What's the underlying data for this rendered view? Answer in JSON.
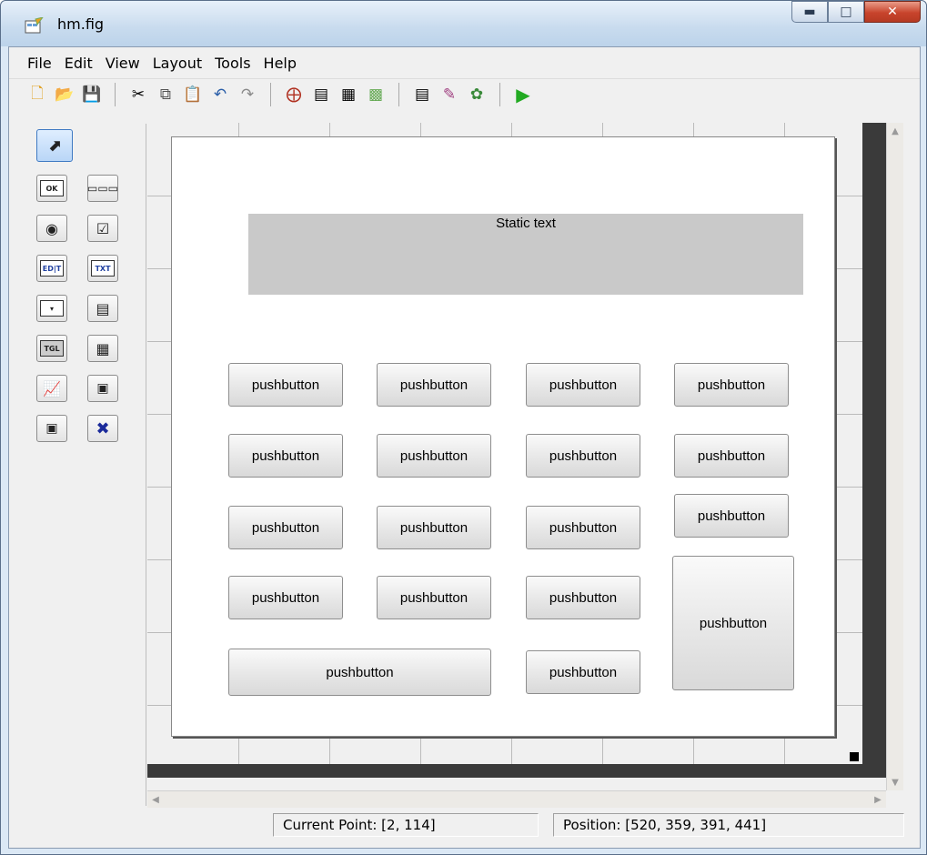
{
  "window": {
    "title": "hm.fig"
  },
  "menu": [
    "File",
    "Edit",
    "View",
    "Layout",
    "Tools",
    "Help"
  ],
  "toolbar": [
    "new-file-icon",
    "open-folder-icon",
    "save-icon",
    "cut-icon",
    "copy-icon",
    "paste-icon",
    "undo-icon",
    "redo-icon",
    "align-objects-icon",
    "menu-editor-icon",
    "tab-order-editor-icon",
    "toolbar-editor-icon",
    "m-file-editor-icon",
    "property-inspector-icon",
    "object-browser-icon",
    "run-figure-icon"
  ],
  "palette": {
    "tools": [
      "select",
      "push-button",
      "slider",
      "radio-button",
      "check-box",
      "edit-text",
      "static-text",
      "popup-menu",
      "listbox",
      "toggle-button",
      "table",
      "axes",
      "panel",
      "button-group",
      "activex-control"
    ],
    "labels": {
      "pushbutton": "OK",
      "edit": "ED|T",
      "text": "TXT",
      "toggle": "TGL"
    }
  },
  "canvas": {
    "static_text": "Static text",
    "pushbutton_label": "pushbutton"
  },
  "status": {
    "current_point": "Current Point:  [2, 114]",
    "position": "Position: [520, 359, 391, 441]"
  },
  "colors": {
    "accent": "#3f7ac3",
    "run": "#22aa22",
    "close": "#c8442c"
  }
}
